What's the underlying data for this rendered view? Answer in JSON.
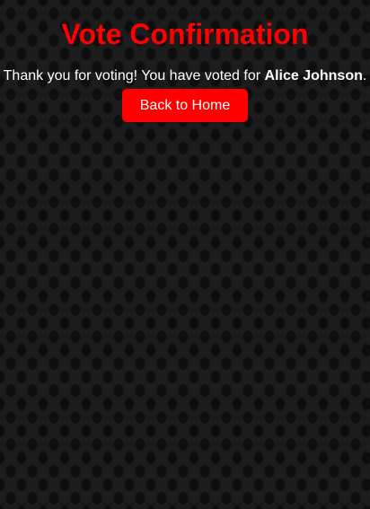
{
  "header": {
    "title": "Vote Confirmation"
  },
  "confirmation": {
    "message_prefix": "Thank you for voting! You have voted for ",
    "candidate": "Alice Johnson",
    "message_suffix": "."
  },
  "actions": {
    "home_label": "Back to Home"
  },
  "colors": {
    "accent": "#ff0000",
    "background": "#151515",
    "text": "#ffffff"
  }
}
